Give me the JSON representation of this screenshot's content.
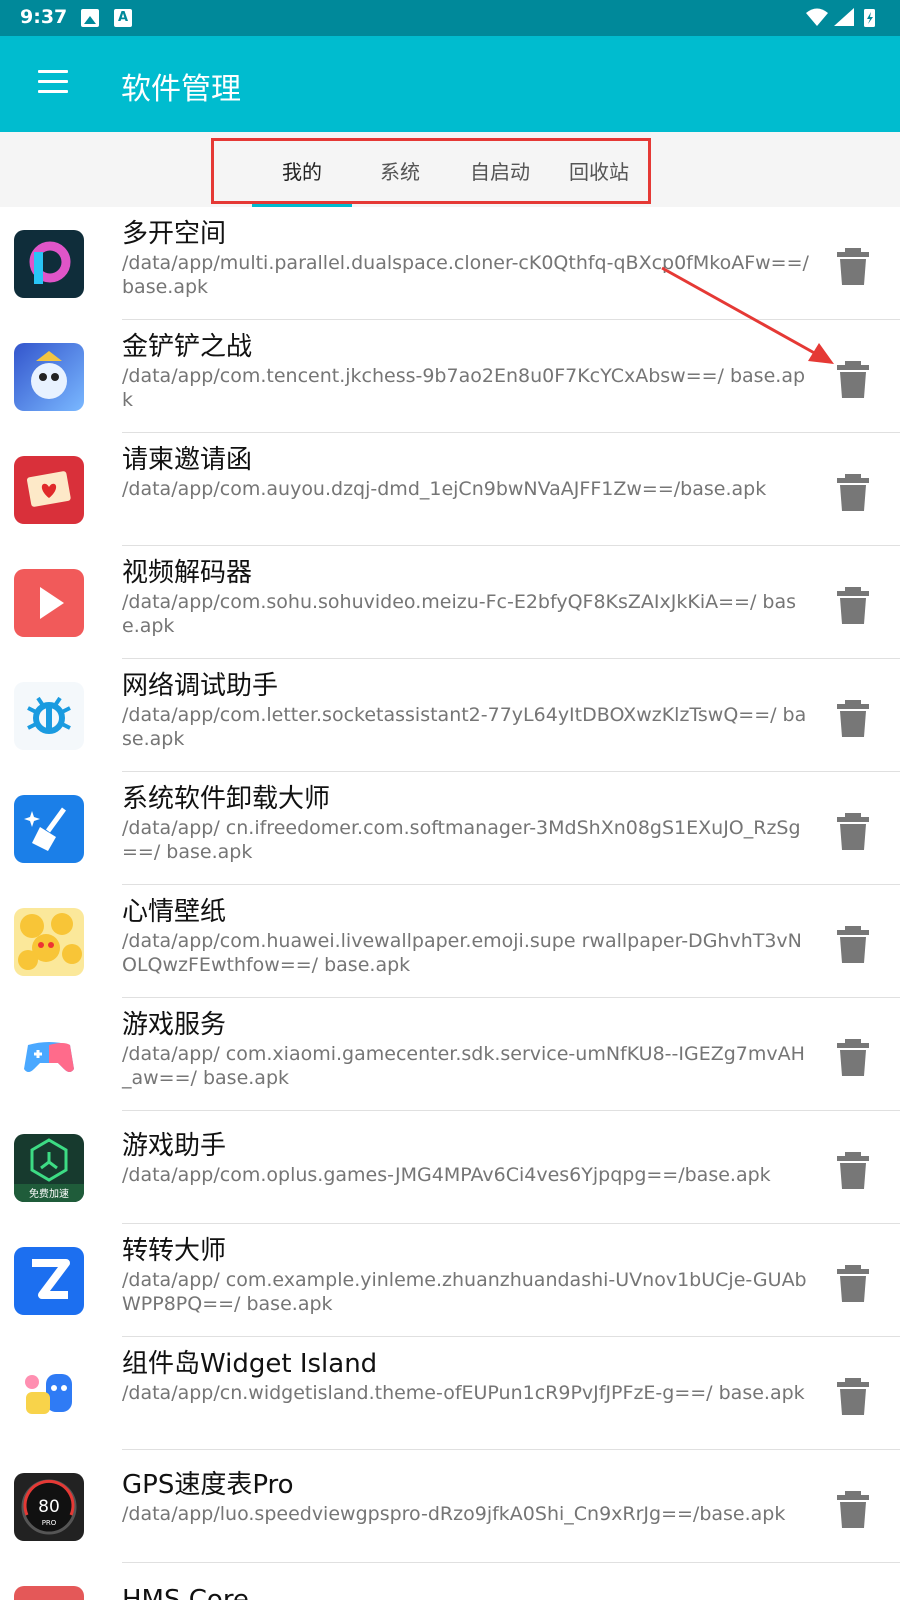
{
  "status_bar": {
    "time": "9:37",
    "icon_a": "A"
  },
  "toolbar": {
    "title": "软件管理",
    "menu_icon": "hamburger-menu-icon"
  },
  "tabs": [
    {
      "label": "我的",
      "active": true
    },
    {
      "label": "系统",
      "active": false
    },
    {
      "label": "自启动",
      "active": false
    },
    {
      "label": "回收站",
      "active": false
    }
  ],
  "colors": {
    "accent": "#00bccf",
    "status_bar": "#00899a",
    "highlight": "#e53935"
  },
  "apps": [
    {
      "name": "多开空间",
      "path": "/data/app/multi.parallel.dualspace.cloner-cK0Qthfq-qBXcp0fMkoAFw==/ base.apk"
    },
    {
      "name": "金铲铲之战",
      "path": "/data/app/com.tencent.jkchess-9b7ao2En8u0F7KcYCxAbsw==/ base.apk"
    },
    {
      "name": "请柬邀请函",
      "path": "/data/app/com.auyou.dzqj-dmd_1ejCn9bwNVaAJFF1Zw==/base.apk"
    },
    {
      "name": "视频解码器",
      "path": "/data/app/com.sohu.sohuvideo.meizu-Fc-E2bfyQF8KsZAIxJkKiA==/ base.apk"
    },
    {
      "name": "网络调试助手",
      "path": "/data/app/com.letter.socketassistant2-77yL64yItDBOXwzKlzTswQ==/ base.apk"
    },
    {
      "name": "系统软件卸载大师",
      "path": "/data/app/ cn.ifreedomer.com.softmanager-3MdShXn08gS1EXuJO_RzSg==/ base.apk"
    },
    {
      "name": "心情壁纸",
      "path": "/data/app/com.huawei.livewallpaper.emoji.supe rwallpaper-DGhvhT3vNOLQwzFEwthfow==/ base.apk"
    },
    {
      "name": "游戏服务",
      "path": "/data/app/ com.xiaomi.gamecenter.sdk.service-umNfKU8--IGEZg7mvAH_aw==/ base.apk"
    },
    {
      "name": "游戏助手",
      "path": "/data/app/com.oplus.games-JMG4MPAv6Ci4ves6Yjpqpg==/base.apk",
      "icon_caption": "免费加速"
    },
    {
      "name": "转转大师",
      "path": "/data/app/ com.example.yinleme.zhuanzhuandashi-UVnov1bUCje-GUAbWPP8PQ==/ base.apk"
    },
    {
      "name": "组件岛Widget Island",
      "path": "/data/app/cn.widgetisland.theme-ofEUPun1cR9PvJfJPFzE-g==/ base.apk"
    },
    {
      "name": "GPS速度表Pro",
      "path": "/data/app/luo.speedviewgpspro-dRzo9jfkA0Shi_Cn9xRrJg==/base.apk",
      "icon_speed": "80",
      "icon_caption": "PRO"
    },
    {
      "name": "HMS Core",
      "path": ""
    }
  ]
}
